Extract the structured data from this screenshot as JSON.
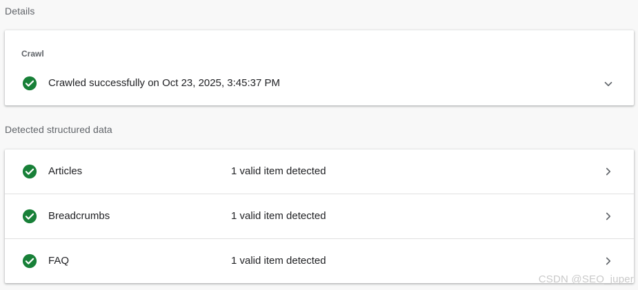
{
  "details": {
    "section_title": "Details",
    "crawl": {
      "label": "Crawl",
      "status_text": "Crawled successfully on Oct 23, 2025, 3:45:37 PM",
      "status_icon": "check-circle-icon",
      "expand_icon": "chevron-down-icon"
    }
  },
  "structured_data": {
    "section_title": "Detected structured data",
    "items": [
      {
        "name": "Articles",
        "status": "1 valid item detected",
        "icon": "check-circle-icon"
      },
      {
        "name": "Breadcrumbs",
        "status": "1 valid item detected",
        "icon": "check-circle-icon"
      },
      {
        "name": "FAQ",
        "status": "1 valid item detected",
        "icon": "check-circle-icon"
      }
    ]
  },
  "watermark": "CSDN @SEO_juper",
  "colors": {
    "success_green": "#188038",
    "icon_gray": "#5f6368",
    "background": "#f8f8f8"
  }
}
